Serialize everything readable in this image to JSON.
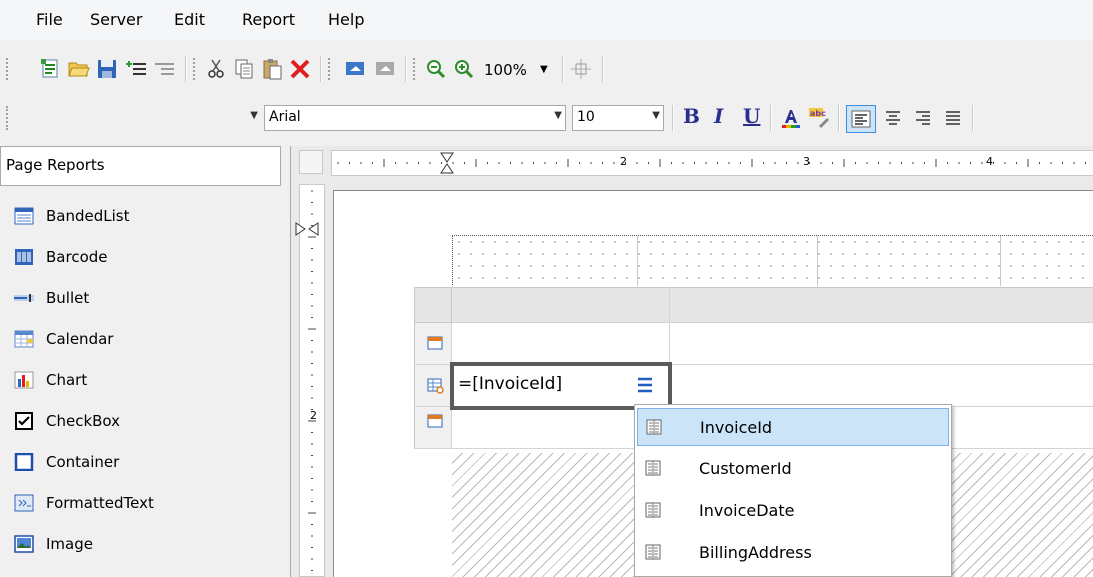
{
  "menubar": {
    "items": [
      "File",
      "Server",
      "Edit",
      "Report",
      "Help"
    ]
  },
  "toolbar1": {
    "buttons": [
      "new-report-icon",
      "open-icon",
      "save-icon",
      "add-section-icon",
      "remove-section-icon",
      "cut-icon",
      "copy-icon",
      "paste-icon",
      "delete-icon",
      "undo-icon",
      "redo-icon",
      "zoom-out-icon",
      "zoom-in-icon",
      "fit-icon"
    ],
    "zoom": "100%"
  },
  "toolbar2": {
    "style_value": "",
    "font": "Arial",
    "size": "10",
    "bold_label": "B",
    "italic_label": "I",
    "underline_label": "U"
  },
  "left_panel": {
    "title": "Page Reports",
    "items": [
      "BandedList",
      "Barcode",
      "Bullet",
      "Calendar",
      "Chart",
      "CheckBox",
      "Container",
      "FormattedText",
      "Image"
    ]
  },
  "ruler": {
    "h_labels": [
      "2",
      "3",
      "4"
    ],
    "v_labels": [
      "2"
    ]
  },
  "table": {
    "cell_expression": "=[InvoiceId]"
  },
  "field_dropdown": {
    "items": [
      "InvoiceId",
      "CustomerId",
      "InvoiceDate",
      "BillingAddress"
    ],
    "selected": "InvoiceId"
  },
  "colors": {
    "accent_blue": "#1f5fbf",
    "selection": "#cce4f7",
    "delete_red": "#e02020"
  }
}
